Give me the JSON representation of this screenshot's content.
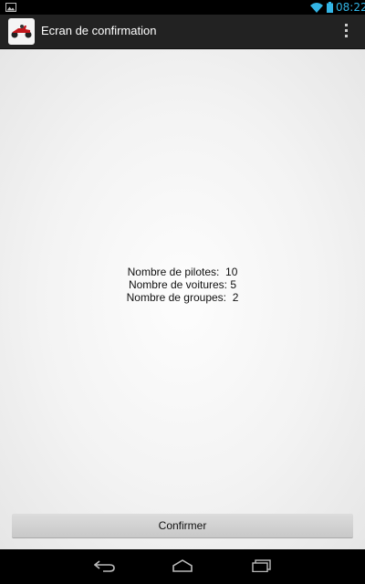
{
  "status_bar": {
    "time": "08:22",
    "icons": [
      "notification-image-icon",
      "wifi-icon",
      "battery-icon"
    ]
  },
  "action_bar": {
    "title": "Ecran de confirmation",
    "app_icon": "kart-icon",
    "menu_icon": "overflow-menu-icon"
  },
  "summary": {
    "pilots_label": "Nombre de pilotes:",
    "pilots_value": "10",
    "cars_label": "Nombre de voitures:",
    "cars_value": "5",
    "groups_label": "Nombre de groupes:",
    "groups_value": "2"
  },
  "confirm_button": {
    "label": "Confirmer"
  },
  "nav_bar": {
    "icons": [
      "back-icon",
      "home-icon",
      "recents-icon"
    ]
  },
  "colors": {
    "status_accent": "#33b5e5",
    "action_bar": "#222222",
    "content_bg": "#f3f3f3",
    "button_bg": "#d0d0d0"
  }
}
